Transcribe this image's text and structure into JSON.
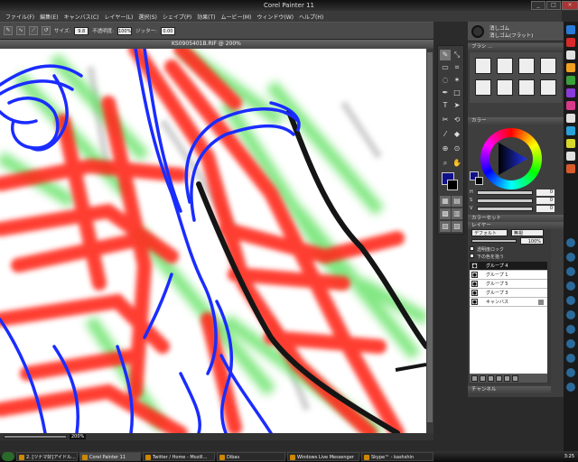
{
  "window": {
    "title": "Corel Painter 11",
    "minimize": "_",
    "maximize": "□",
    "close": "×"
  },
  "menu": [
    "ファイル(F)",
    "編集(E)",
    "キャンバス(C)",
    "レイヤー(L)",
    "選択(S)",
    "シェイプ(P)",
    "効果(T)",
    "ムービー(M)",
    "ウィンドウ(W)",
    "ヘルプ(H)"
  ],
  "property_bar": {
    "size_label": "サイズ:",
    "size_value": "9.8",
    "opacity_label": "不透明度:",
    "opacity_value": "100%",
    "jitter_label": "ジッター:",
    "jitter_value": "0.00"
  },
  "canvas": {
    "title": "KS0905401B.RIF @ 200%",
    "zoom": "200%"
  },
  "brush_selector": {
    "category": "消しゴム",
    "variant": "消しゴム(フラット)"
  },
  "panels": {
    "brushes_header": "ブラシ ...",
    "color_header": "カラー",
    "mixer_header": "カラーセット",
    "layers_header": "レイヤー",
    "channels_header": "チャンネル"
  },
  "color_sliders": [
    {
      "label": "H",
      "value": "0"
    },
    {
      "label": "S",
      "value": "0"
    },
    {
      "label": "V",
      "value": "0"
    }
  ],
  "colors": {
    "main": "#10108a",
    "secondary": "#000000"
  },
  "layers_panel": {
    "composite": "デフォルト",
    "method": "無視",
    "opacity": "100%",
    "preserve_label": "透明度ロック",
    "pick_label": "下の色を拾う",
    "items": [
      {
        "name": "グループ 4",
        "active": true
      },
      {
        "name": "グループ 1",
        "active": false
      },
      {
        "name": "グループ 5",
        "active": false
      },
      {
        "name": "グループ 3",
        "active": false
      },
      {
        "name": "キャンバス",
        "active": false
      }
    ]
  },
  "taskbar": {
    "items": [
      "2. [ツナマ好]アイドル...",
      "Corel Painter 11",
      "Twitter / Home - Mozill...",
      "Dibas",
      "Windows Live Messenger",
      "Skype™ - kashshin"
    ],
    "clock": "3:25"
  }
}
